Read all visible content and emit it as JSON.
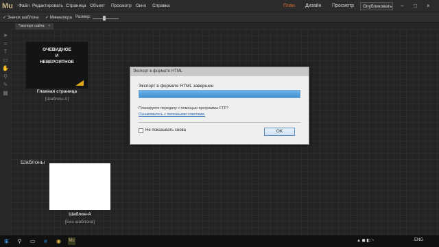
{
  "app": {
    "logo": "Mu"
  },
  "menu": {
    "items": [
      "Файл",
      "Редактировать",
      "Страница",
      "Объект",
      "Просмотр",
      "Окно",
      "Справка"
    ]
  },
  "modes": {
    "plan": "План",
    "design": "Дизайн",
    "preview": "Просмотр",
    "publish": "Опубликовать"
  },
  "toolbar": {
    "master_check": "✓",
    "master_label": "Значок шаблона",
    "thumb_check": "✓",
    "thumb_label": "Миниатюра",
    "size_label": "Размер:"
  },
  "tab": {
    "label": "*экспорт сайта",
    "close": "×"
  },
  "home_page": {
    "thumb_line1": "ОЧЕВИДНОЕ",
    "thumb_line2": "И",
    "thumb_line3": "НЕВЕРОЯТНОЕ",
    "name": "Главная страница",
    "master": "[Шаблон-A]"
  },
  "masters": {
    "section_title": "Шаблоны",
    "name": "Шаблон-A",
    "master": "[Без шаблона]"
  },
  "dialog": {
    "title": "Экспорт в формате HTML",
    "message": "Экспорт в формате HTML завершен",
    "progress": 1.0,
    "question": "Планируете передачу с помощью программы FTP?",
    "link": "Ознакомьтесь с полезными советами.",
    "checkbox_label": "Не показывать снова",
    "ok_label": "OK"
  },
  "taskbar": {
    "lang": "ENG"
  },
  "colors": {
    "accent": "#e06a2c",
    "progress": "#3c8fd0",
    "logo": "#c8b48a"
  }
}
